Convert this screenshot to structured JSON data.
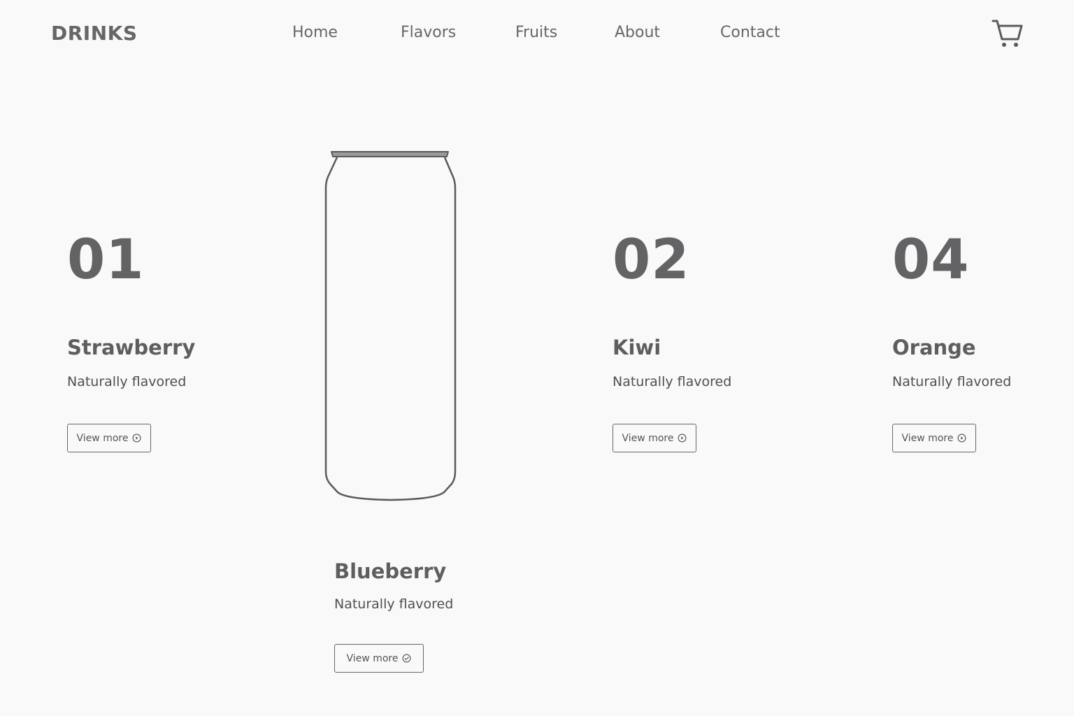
{
  "header": {
    "brand": "DRINKS",
    "nav": [
      {
        "label": "Home"
      },
      {
        "label": "Flavors"
      },
      {
        "label": "Fruits"
      },
      {
        "label": "About"
      },
      {
        "label": "Contact"
      }
    ],
    "cart_icon": "cart-icon"
  },
  "products": [
    {
      "number": "01",
      "name": "Strawberry",
      "description": "Naturally flavored",
      "button_label": "View more"
    },
    {
      "number": "02",
      "name": "Kiwi",
      "description": "Naturally flavored",
      "button_label": "View more"
    },
    {
      "number": "04",
      "name": "Orange",
      "description": "Naturally flavored",
      "button_label": "View more"
    }
  ],
  "featured": {
    "name": "Blueberry",
    "description": "Naturally flavored",
    "button_label": "View more",
    "image_icon": "can-outline"
  },
  "colors": {
    "background": "#f9f9f9",
    "text": "#5a5a5c",
    "outline": "#666666"
  }
}
